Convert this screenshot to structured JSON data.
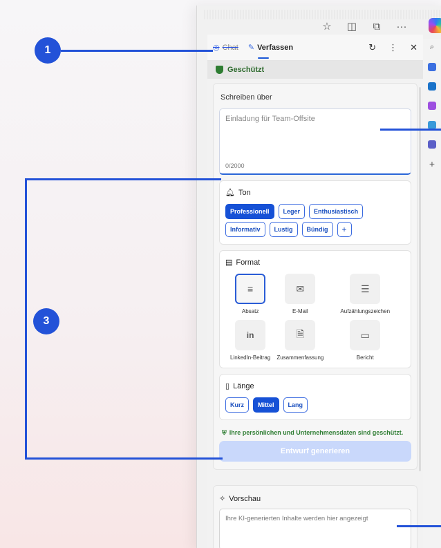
{
  "browser": {
    "toolbar_icons": [
      "star-icon",
      "split-screen-icon",
      "collections-icon",
      "more-icon"
    ],
    "more_label": "···"
  },
  "panel": {
    "tabs": [
      {
        "label": "Chat"
      },
      {
        "label": "Verfassen"
      }
    ],
    "actions": [
      "refresh-icon",
      "more-vertical-icon",
      "close-icon"
    ],
    "protected_label": "Geschützt",
    "write_about": {
      "label": "Schreiben über",
      "placeholder": "Einladung für Team-Offsite",
      "counter": "0/2000"
    },
    "tone": {
      "title": "Ton",
      "options": [
        "Professionell",
        "Leger",
        "Enthusiastisch",
        "Informativ",
        "Lustig",
        "Bündig"
      ],
      "selected": "Professionell",
      "add": "+"
    },
    "format": {
      "title": "Format",
      "options": [
        "Absatz",
        "E-Mail",
        "Aufzählungszeichen",
        "LinkedIn-Beitrag",
        "Zusammenfassung",
        "Bericht"
      ],
      "selected": "Absatz"
    },
    "length": {
      "title": "Länge",
      "options": [
        "Kurz",
        "Mittel",
        "Lang"
      ],
      "selected": "Mittel"
    },
    "privacy_note": "Ihre persönlichen und Unternehmensdaten sind geschützt.",
    "generate_button": "Entwurf generieren",
    "preview": {
      "title": "Vorschau",
      "placeholder": "Ihre KI-generierten Inhalte werden hier angezeigt"
    }
  },
  "callouts": {
    "one": "1",
    "three": "3"
  },
  "colors": {
    "accent": "#1651d6",
    "callout": "#2352d8",
    "protected_green": "#2e7d32"
  }
}
